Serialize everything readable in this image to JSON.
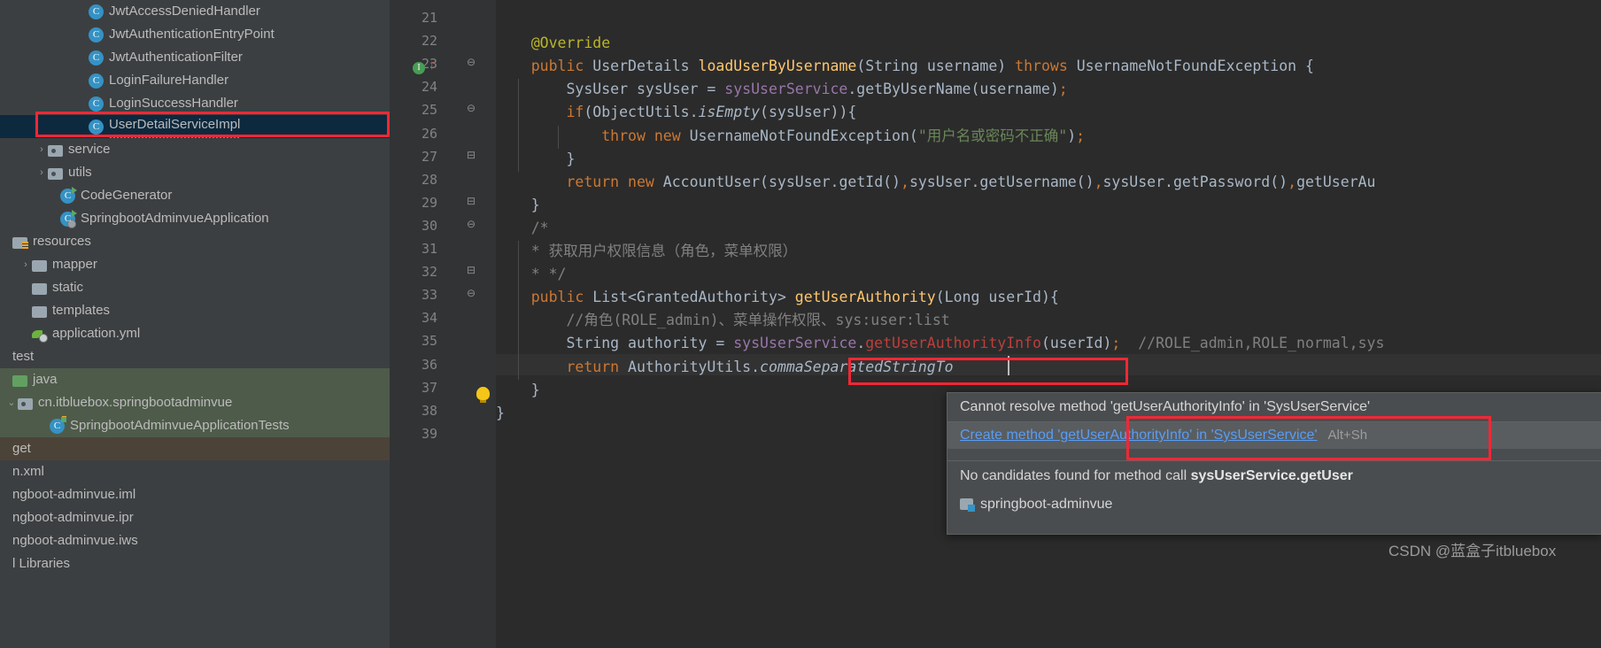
{
  "sidebar": {
    "rows": [
      {
        "label": "JwtAccessDeniedHandler",
        "icon": "java-class-icon",
        "indent": 86,
        "type": "class",
        "state": "none"
      },
      {
        "label": "JwtAuthenticationEntryPoint",
        "icon": "java-class-icon",
        "indent": 86,
        "type": "class",
        "state": "none"
      },
      {
        "label": "JwtAuthenticationFilter",
        "icon": "java-class-icon",
        "indent": 86,
        "type": "class",
        "state": "none"
      },
      {
        "label": "LoginFailureHandler",
        "icon": "java-class-icon",
        "indent": 86,
        "type": "class",
        "state": "none"
      },
      {
        "label": "LoginSuccessHandler",
        "icon": "java-class-icon",
        "indent": 86,
        "type": "class",
        "state": "none"
      },
      {
        "label": "UserDetailServiceImpl",
        "icon": "java-class-icon",
        "indent": 86,
        "type": "class",
        "state": "selected"
      },
      {
        "label": "service",
        "icon": "package-icon",
        "indent": 40,
        "type": "package",
        "state": "none",
        "arrow": "›"
      },
      {
        "label": "utils",
        "icon": "package-icon",
        "indent": 40,
        "type": "package",
        "state": "none",
        "arrow": "›"
      },
      {
        "label": "CodeGenerator",
        "icon": "runnable-class-icon",
        "indent": 54,
        "type": "runclass",
        "state": "none"
      },
      {
        "label": "SpringbootAdminvueApplication",
        "icon": "spring-boot-class-icon",
        "indent": 54,
        "type": "spring",
        "state": "none"
      },
      {
        "label": "resources",
        "icon": "resources-folder-icon",
        "indent": 0,
        "type": "res",
        "state": "none"
      },
      {
        "label": "mapper",
        "icon": "folder-icon",
        "indent": 22,
        "type": "folder",
        "state": "none",
        "arrow": "›"
      },
      {
        "label": "static",
        "icon": "folder-icon",
        "indent": 22,
        "type": "folder",
        "state": "none"
      },
      {
        "label": "templates",
        "icon": "folder-icon",
        "indent": 22,
        "type": "folder",
        "state": "none"
      },
      {
        "label": "application.yml",
        "icon": "yaml-file-icon",
        "indent": 22,
        "type": "yml",
        "state": "none"
      },
      {
        "label": "test",
        "icon": "none",
        "indent": -16,
        "type": "plain",
        "state": "none"
      },
      {
        "label": "java",
        "icon": "source-folder-icon",
        "indent": -16,
        "type": "folder-green",
        "state": "green"
      },
      {
        "label": "cn.itbluebox.springbootadminvue",
        "icon": "package-icon",
        "indent": 6,
        "type": "package",
        "state": "green",
        "arrow": "⌄"
      },
      {
        "label": "SpringbootAdminvueApplicationTests",
        "icon": "test-class-icon",
        "indent": 42,
        "type": "test",
        "state": "green"
      },
      {
        "label": "get",
        "icon": "none",
        "indent": -16,
        "type": "plain",
        "state": "brown"
      },
      {
        "label": "n.xml",
        "icon": "none",
        "indent": -16,
        "type": "plain",
        "state": "none"
      },
      {
        "label": "ngboot-adminvue.iml",
        "icon": "none",
        "indent": -16,
        "type": "plain",
        "state": "none"
      },
      {
        "label": "ngboot-adminvue.ipr",
        "icon": "none",
        "indent": -16,
        "type": "plain",
        "state": "none"
      },
      {
        "label": "ngboot-adminvue.iws",
        "icon": "none",
        "indent": -16,
        "type": "plain",
        "state": "none"
      },
      {
        "label": "l Libraries",
        "icon": "none",
        "indent": -16,
        "type": "plain",
        "state": "none"
      }
    ]
  },
  "editor": {
    "line_numbers": [
      "21",
      "22",
      "23",
      "24",
      "25",
      "26",
      "27",
      "28",
      "29",
      "30",
      "31",
      "32",
      "33",
      "34",
      "35",
      "36",
      "37",
      "38",
      "39"
    ],
    "lines": [
      {
        "n": "21",
        "html": ""
      },
      {
        "n": "22",
        "html": "    <span class='ann'>@Override</span>"
      },
      {
        "n": "23",
        "html": "    <span class='kw'>public</span> <span class='id'>UserDetails</span> <span class='fn'>loadUserByUsername</span><span class='id'>(</span><span class='id'>String</span> <span class='id'>username</span><span class='id'>)</span> <span class='kw'>throws</span> <span class='id'>UsernameNotFoundException</span> <span class='id'>{</span>"
      },
      {
        "n": "24",
        "html": "        <span class='id'>SysUser sysUser = </span><span class='fld'>sysUserService</span><span class='id'>.getByUserName(username)</span><span class='kw'>;</span>"
      },
      {
        "n": "25",
        "html": "        <span class='kw'>if</span><span class='id'>(ObjectUtils.</span><span class='id ital'>isEmpty</span><span class='id'>(sysUser)){</span>"
      },
      {
        "n": "26",
        "html": "            <span class='kw'>throw</span> <span class='kw'>new</span> <span class='id'>UsernameNotFoundException(</span><span class='str'>\"用户名或密码不正确\"</span><span class='id'>)</span><span class='kw'>;</span>"
      },
      {
        "n": "27",
        "html": "        <span class='id'>}</span>"
      },
      {
        "n": "28",
        "html": "        <span class='kw'>return</span> <span class='kw'>new</span> <span class='id'>AccountUser(sysUser.getId()</span><span class='kw'>,</span><span class='id'>sysUser.getUsername()</span><span class='kw'>,</span><span class='id'>sysUser.getPassword()</span><span class='kw'>,</span><span class='id'>getUserAu</span>"
      },
      {
        "n": "29",
        "html": "    <span class='id'>}</span>"
      },
      {
        "n": "30",
        "html": "    <span class='cmt'>/*</span>"
      },
      {
        "n": "31",
        "html": "    <span class='cmt'>* 获取用户权限信息（角色，菜单权限）</span>"
      },
      {
        "n": "32",
        "html": "    <span class='cmt'>* */</span>"
      },
      {
        "n": "33",
        "html": "    <span class='kw'>public</span> <span class='id'>List&lt;GrantedAuthority&gt;</span> <span class='fn'>getUserAuthority</span><span class='id'>(Long userId){</span>"
      },
      {
        "n": "34",
        "html": "        <span class='cmt'>//角色(ROLE_admin)、菜单操作权限、sys:user:list</span>"
      },
      {
        "n": "35",
        "html": "        <span class='id'>String authority = </span><span class='fld'>sysUserService</span><span class='id'>.</span><span class='err'>getUserAuthorityInfo</span><span class='id'>(userId)</span><span class='kw'>;</span>  <span class='cmt'>//ROLE_admin,ROLE_normal,sys</span>"
      },
      {
        "n": "36",
        "html": "        <span class='kw'>return</span> <span class='id'>AuthorityUtils.</span><span class='id ital'>commaSeparatedStringTo</span>"
      },
      {
        "n": "37",
        "html": "    <span class='id'>}</span>"
      },
      {
        "n": "38",
        "html": "<span class='id'>}</span>"
      },
      {
        "n": "39",
        "html": ""
      }
    ],
    "plain_lines": [
      "",
      "    @Override",
      "    public UserDetails loadUserByUsername(String username) throws UsernameNotFoundException {",
      "        SysUser sysUser = sysUserService.getByUserName(username);",
      "        if(ObjectUtils.isEmpty(sysUser)){",
      "            throw new UsernameNotFoundException(\"用户名或密码不正确\");",
      "        }",
      "        return new AccountUser(sysUser.getId(),sysUser.getUsername(),sysUser.getPassword(),getUserAu",
      "    }",
      "    /*",
      "    * 获取用户权限信息（角色，菜单权限）",
      "    * */",
      "    public List<GrantedAuthority> getUserAuthority(Long userId){",
      "        //角色(ROLE_admin)、菜单操作权限、sys:user:list",
      "        String authority = sysUserService.getUserAuthorityInfo(userId);  //ROLE_admin,ROLE_normal,sys",
      "        return AuthorityUtils.commaSeparatedStringTo",
      "    }",
      "}",
      ""
    ]
  },
  "tooltip": {
    "error_message": "Cannot resolve method 'getUserAuthorityInfo' in 'SysUserService'",
    "action_label": "Create method 'getUserAuthorityInfo' in 'SysUserService'",
    "action_shortcut": "Alt+Sh",
    "candidates_prefix": "No candidates found for method call ",
    "candidates_bold": "sysUserService.getUser",
    "project_name": "springboot-adminvue"
  },
  "watermark": {
    "text": "CSDN @蓝盒子itbluebox"
  },
  "colors": {
    "annotation_red": "#f32735",
    "link_blue": "#589df6",
    "selection_blue": "#0d293e",
    "selection_green": "#4e5b4a",
    "editor_bg": "#2b2b2b",
    "sidebar_bg": "#3c3f41"
  }
}
